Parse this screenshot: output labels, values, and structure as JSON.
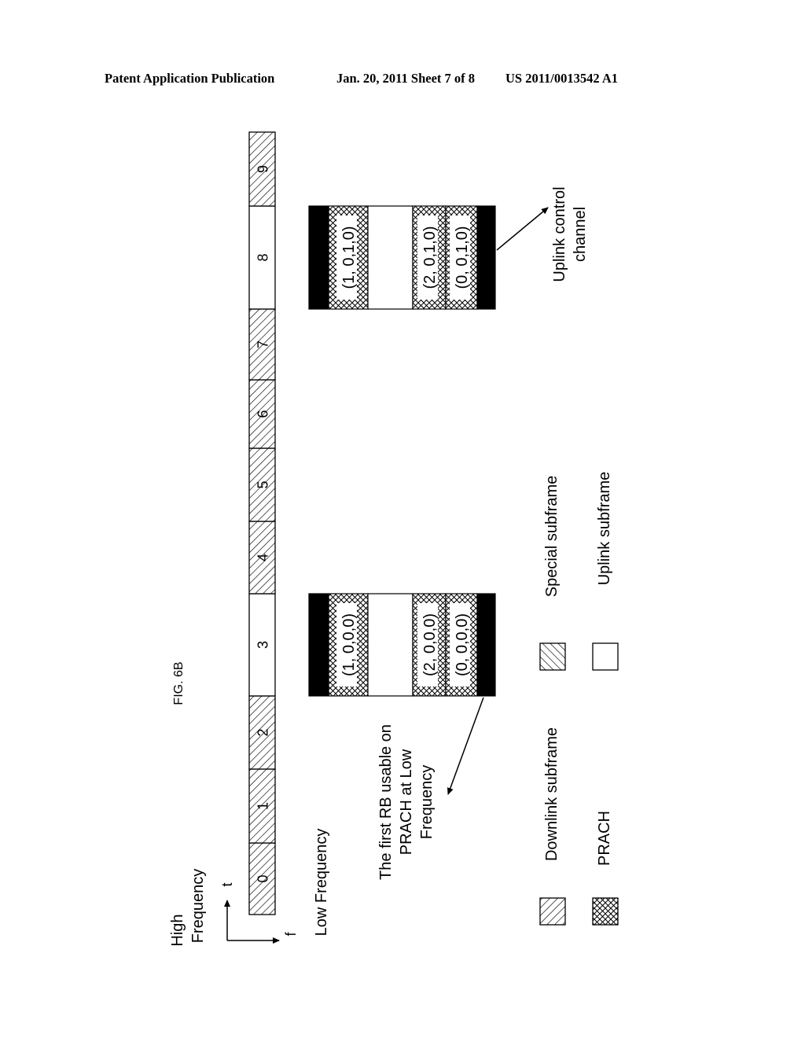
{
  "header": {
    "left": "Patent Application Publication",
    "middle": "Jan. 20, 2011   Sheet 7 of 8",
    "right": "US 2011/0013542 A1"
  },
  "figure": {
    "label": "FIG. 6B",
    "axes": {
      "high_frequency_line1": "High",
      "high_frequency_line2": "Frequency",
      "low_frequency": "Low Frequency",
      "t_label": "t",
      "f_label": "f"
    },
    "subframes": [
      {
        "index": "0",
        "type": "downlink"
      },
      {
        "index": "1",
        "type": "downlink"
      },
      {
        "index": "2",
        "type": "downlink"
      },
      {
        "index": "3",
        "type": "uplink"
      },
      {
        "index": "4",
        "type": "downlink"
      },
      {
        "index": "5",
        "type": "downlink"
      },
      {
        "index": "6",
        "type": "downlink"
      },
      {
        "index": "7",
        "type": "downlink"
      },
      {
        "index": "8",
        "type": "uplink"
      },
      {
        "index": "9",
        "type": "downlink"
      }
    ],
    "blocks": [
      {
        "under_subframe": "3",
        "columns": [
          {
            "type": "control",
            "label": ""
          },
          {
            "type": "prach",
            "label": "(1, 0,0,0)"
          },
          {
            "type": "uplink",
            "label": ""
          },
          {
            "type": "prach",
            "label": "(2, 0,0,0)"
          },
          {
            "type": "prach",
            "label": "(0, 0,0,0)"
          },
          {
            "type": "control",
            "label": ""
          }
        ]
      },
      {
        "under_subframe": "8",
        "columns": [
          {
            "type": "control",
            "label": ""
          },
          {
            "type": "prach",
            "label": "(1, 0,1,0)"
          },
          {
            "type": "uplink",
            "label": ""
          },
          {
            "type": "prach",
            "label": "(2, 0,1,0)"
          },
          {
            "type": "prach",
            "label": "(0, 0,1,0)"
          },
          {
            "type": "control",
            "label": ""
          }
        ]
      }
    ],
    "annotations": {
      "first_rb_line1": "The first RB usable on",
      "first_rb_line2": "PRACH at Low",
      "first_rb_line3": "Frequency",
      "uplink_control_line1": "Uplink control",
      "uplink_control_line2": "channel"
    },
    "legend": [
      {
        "key": "downlink",
        "label": "Downlink subframe"
      },
      {
        "key": "special",
        "label": "Special subframe"
      },
      {
        "key": "prach",
        "label": "PRACH"
      },
      {
        "key": "uplink",
        "label": "Uplink subframe"
      }
    ]
  }
}
